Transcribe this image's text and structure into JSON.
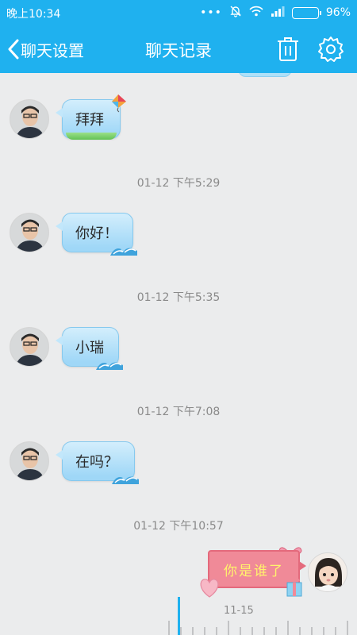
{
  "status_bar": {
    "time": "晚上10:34",
    "battery": "96%",
    "battery_level": 0.96
  },
  "header": {
    "back_label": "聊天设置",
    "title": "聊天记录"
  },
  "messages": [
    {
      "sender": "other",
      "text": "拜拜",
      "avatar": "male-avatar"
    },
    {
      "timestamp": "01-12 下午5:29",
      "sender": "other",
      "text": "你好！",
      "avatar": "male-avatar"
    },
    {
      "timestamp": "01-12 下午5:35",
      "sender": "other",
      "text": "小瑞",
      "avatar": "male-avatar"
    },
    {
      "timestamp": "01-12 下午7:08",
      "sender": "other",
      "text": "在吗？",
      "avatar": "male-avatar"
    },
    {
      "timestamp": "01-12 下午10:57",
      "sender": "me",
      "text": "你是谁了",
      "avatar": "female-avatar"
    }
  ],
  "timeline": {
    "date_label": "11-15"
  },
  "colors": {
    "accent": "#1fb1ef",
    "background": "#ebeced",
    "bubble": "#aedff8",
    "sent_bubble": "#f08a98"
  }
}
